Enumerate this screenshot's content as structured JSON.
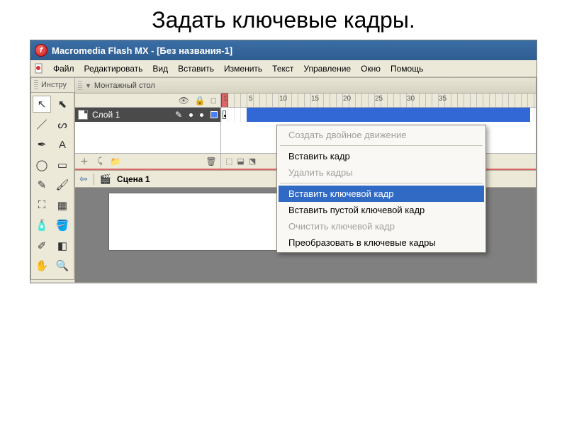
{
  "page_title": "Задать ключевые кадры.",
  "titlebar": "Macromedia Flash MX - [Без названия-1]",
  "menu": {
    "file": "Файл",
    "edit": "Редактировать",
    "view": "Вид",
    "insert": "Вставить",
    "modify": "Изменить",
    "text": "Текст",
    "control": "Управление",
    "window": "Окно",
    "help": "Помощь"
  },
  "panels": {
    "tools_label": "Инстру",
    "timeline_label": "Монтажный стол"
  },
  "layer": {
    "name": "Слой 1"
  },
  "ruler": {
    "n1": "1",
    "n5": "5",
    "n10": "10",
    "n15": "15",
    "n20": "20",
    "n25": "25",
    "n30": "30",
    "n35": "35"
  },
  "scene": {
    "label": "Сцена 1"
  },
  "context_menu": {
    "create_tween": "Создать двойное движение",
    "insert_frame": "Вставить кадр",
    "remove_frames": "Удалить кадры",
    "insert_keyframe": "Вставить ключевой кадр",
    "insert_blank_keyframe": "Вставить пустой ключевой кадр",
    "clear_keyframe": "Очистить ключевой кадр",
    "convert_keyframes": "Преобразовать в ключевые кадры"
  },
  "icons": {
    "arrow": "↖",
    "subselect": "⬉",
    "line": "／",
    "lasso": "ᔕ",
    "pen": "✒",
    "textA": "A",
    "oval": "◯",
    "rect": "▭",
    "pencil": "✎",
    "brush": "🖌",
    "transform": "⛶",
    "fillTransform": "▦",
    "ink": "🧴",
    "bucket": "🪣",
    "dropper": "✐",
    "eraser": "◧",
    "hand": "✋",
    "zoom": "🔍",
    "eye": "👁",
    "lock": "🔒",
    "outline": "□",
    "folder_plus": "📁",
    "trash": "🗑",
    "clap": "🎬",
    "back": "⇦"
  }
}
